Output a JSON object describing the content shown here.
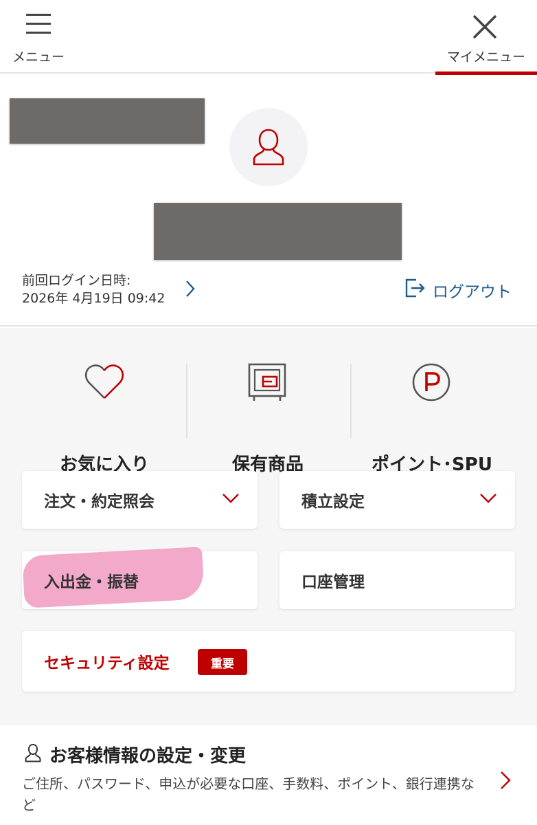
{
  "header": {
    "menu_label": "メニュー",
    "mymenu_label": "マイメニュー"
  },
  "profile": {
    "last_login_label": "前回ログイン日時:",
    "last_login_value": "2026年 4月19日 09:42",
    "logout_label": "ログアウト"
  },
  "quick_links": [
    {
      "label": "お気に入り",
      "icon": "heart-icon"
    },
    {
      "label": "保有商品",
      "icon": "safe-icon"
    },
    {
      "label": "ポイント･SPU",
      "icon": "point-icon"
    }
  ],
  "cards": {
    "orders": "注文・約定照会",
    "accumulation": "積立設定",
    "deposit": "入出金・振替",
    "account": "口座管理",
    "security": "セキュリティ設定",
    "security_badge": "重要"
  },
  "customer": {
    "title": "お客様情報の設定・変更",
    "description": "ご住所、パスワード、申込が必要な口座、手数料、ポイント、銀行連携など"
  },
  "colors": {
    "accent": "#bf0000",
    "link": "#1e5a8c",
    "highlight": "#f19ac1"
  }
}
